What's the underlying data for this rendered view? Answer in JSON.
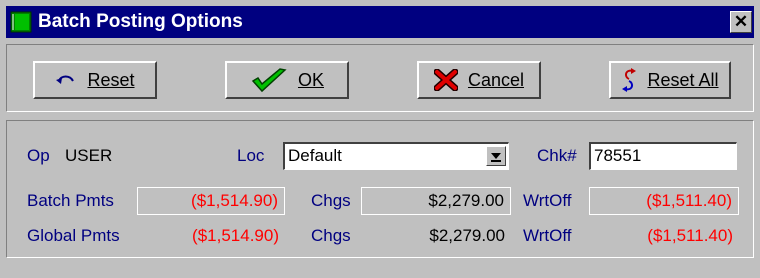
{
  "window": {
    "title": "Batch Posting Options",
    "close_label": "✕"
  },
  "toolbar": {
    "reset_label": "Reset",
    "ok_label": "OK",
    "cancel_label": "Cancel",
    "reset_all_label": "Reset All"
  },
  "form": {
    "op_label": "Op",
    "op_value": "USER",
    "loc_label": "Loc",
    "loc_value": "Default",
    "chk_label": "Chk#",
    "chk_value": "78551",
    "batch_label": "Batch Pmts",
    "batch_pmts": "($1,514.90)",
    "batch_chgs_label": "Chgs",
    "batch_chgs": "$2,279.00",
    "batch_wrtoff_label": "WrtOff",
    "batch_wrtoff": "($1,511.40)",
    "global_label": "Global Pmts",
    "global_pmts": "($1,514.90)",
    "global_chgs_label": "Chgs",
    "global_chgs": "$2,279.00",
    "global_wrtoff_label": "WrtOff",
    "global_wrtoff": "($1,511.40)"
  },
  "colors": {
    "title_bar": "#000080",
    "label": "#000080",
    "negative": "#ff0000"
  },
  "icons": {
    "title": "book-icon",
    "reset": "undo-arrow-icon",
    "ok": "checkmark-icon",
    "cancel": "red-x-icon",
    "reset_all": "refresh-arrows-icon"
  }
}
